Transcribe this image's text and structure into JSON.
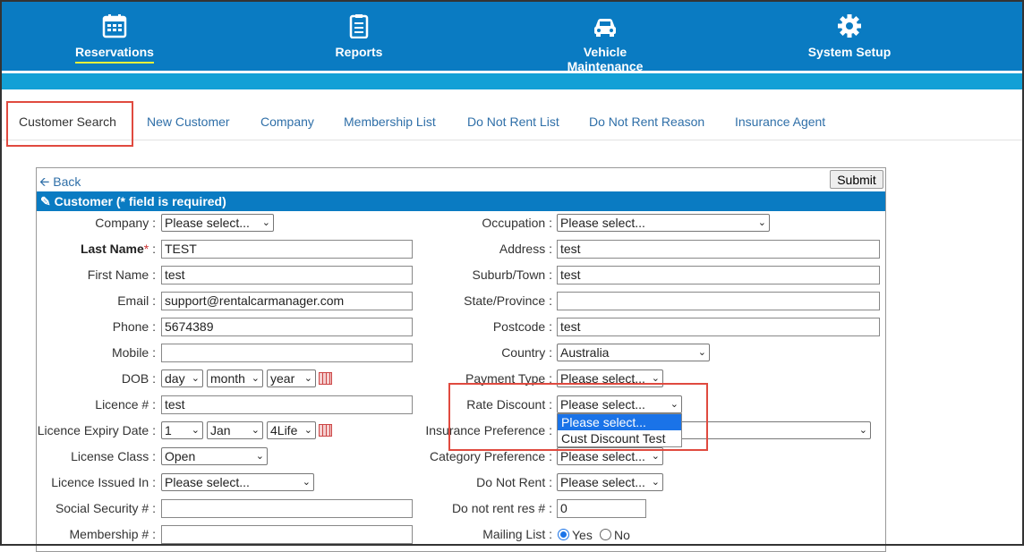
{
  "nav": {
    "reservations": "Reservations",
    "reports": "Reports",
    "vehicle": "Vehicle Maintenance",
    "setup": "System Setup"
  },
  "tabs": [
    "Customer Search",
    "New Customer",
    "Company",
    "Membership List",
    "Do Not Rent List",
    "Do Not Rent Reason",
    "Insurance Agent"
  ],
  "panel": {
    "back": "Back",
    "submit": "Submit",
    "section": "Customer (* field is required)"
  },
  "left": {
    "company_label": "Company :",
    "company_val": "Please select...",
    "lastname_label": "Last Name",
    "lastname_val": "TEST",
    "firstname_label": "First Name :",
    "firstname_val": "test",
    "email_label": "Email :",
    "email_val": "support@rentalcarmanager.com",
    "phone_label": "Phone :",
    "phone_val": "5674389",
    "mobile_label": "Mobile :",
    "mobile_val": "",
    "dob_label": "DOB :",
    "dob_day": "day",
    "dob_month": "month",
    "dob_year": "year",
    "licence_label": "Licence # :",
    "licence_val": "test",
    "expiry_label": "Licence Expiry Date :",
    "exp_day": "1",
    "exp_month": "Jan",
    "exp_year": "4Life",
    "class_label": "License Class :",
    "class_val": "Open",
    "issued_label": "Licence Issued In :",
    "issued_val": "Please select...",
    "ssn_label": "Social Security # :",
    "ssn_val": "",
    "member_label": "Membership # :",
    "member_val": ""
  },
  "right": {
    "occupation_label": "Occupation :",
    "occupation_val": "Please select...",
    "address_label": "Address :",
    "address_val": "test",
    "suburb_label": "Suburb/Town :",
    "suburb_val": "test",
    "state_label": "State/Province :",
    "state_val": "",
    "postcode_label": "Postcode :",
    "postcode_val": "test",
    "country_label": "Country :",
    "country_val": "Australia",
    "payment_label": "Payment Type :",
    "payment_val": "Please select...",
    "rate_label": "Rate Discount :",
    "rate_val": "Please select...",
    "insurance_label": "Insurance Preference :",
    "category_label": "Category Preference :",
    "category_val": "Please select...",
    "dnr_label": "Do Not Rent :",
    "dnr_val": "Please select...",
    "dnrres_label": "Do not rent res # :",
    "dnrres_val": "0",
    "mailing_label": "Mailing List :",
    "yes": "Yes",
    "no": "No"
  },
  "dropdown": [
    "Please select...",
    "Cust Discount Test"
  ],
  "colors": {
    "nav": "#0a7bc2",
    "band": "#13a0d6",
    "highlight": "#e04a3f"
  }
}
